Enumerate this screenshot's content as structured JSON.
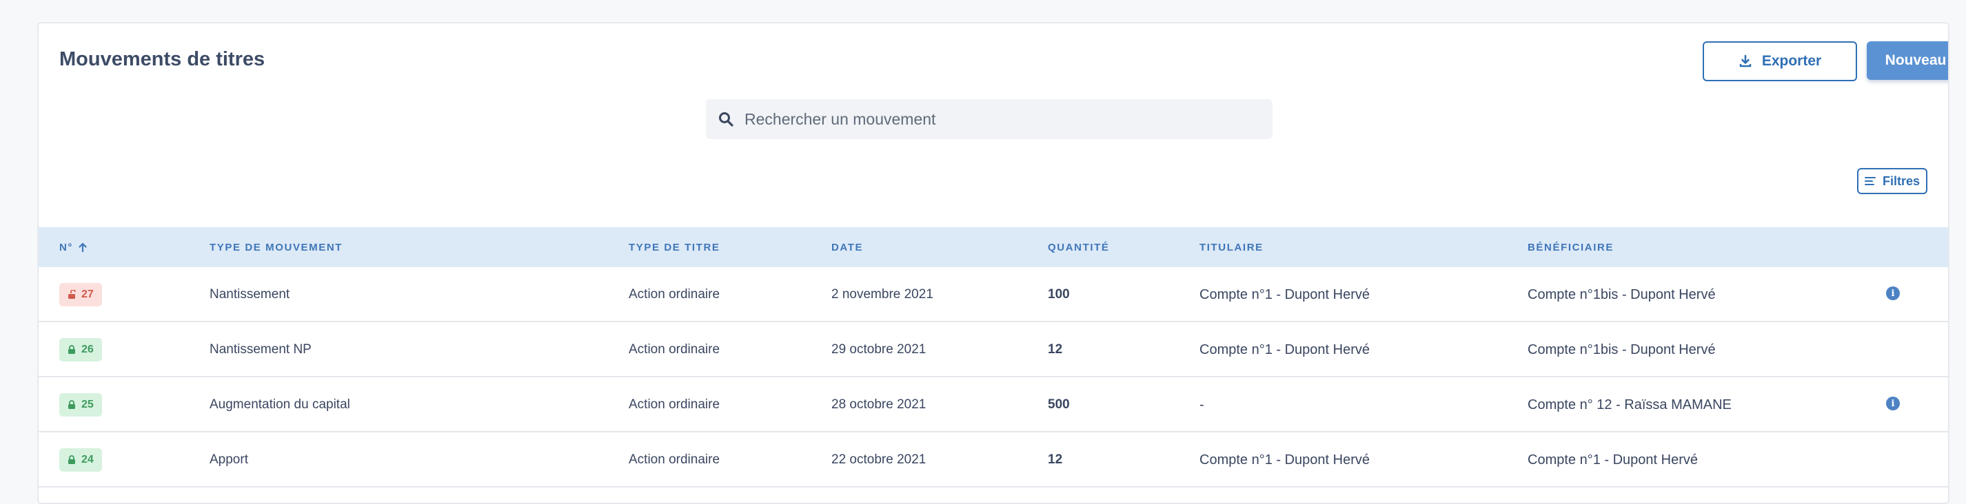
{
  "header": {
    "title": "Mouvements de titres",
    "export_label": "Exporter",
    "new_label": "Nouveau"
  },
  "search": {
    "placeholder": "Rechercher un mouvement"
  },
  "filters": {
    "label": "Filtres"
  },
  "colors": {
    "accent": "#2f6fb5",
    "primary_button": "#5b92d3",
    "header_row": "#dce9f7",
    "badge_red_bg": "#fbe0dd",
    "badge_green_bg": "#d7f2df"
  },
  "table": {
    "columns": {
      "num": "N°",
      "type_mouvement": "TYPE DE MOUVEMENT",
      "type_titre": "TYPE DE TITRE",
      "date": "DATE",
      "quantite": "QUANTITÉ",
      "titulaire": "TITULAIRE",
      "beneficiaire": "BÉNÉFICIAIRE"
    },
    "sort_icon": "arrow-up-icon",
    "rows": [
      {
        "num": "27",
        "badge": "red",
        "icon": "unlock-icon",
        "type_mouvement": "Nantissement",
        "type_titre": "Action ordinaire",
        "date": "2 novembre 2021",
        "quantite": "100",
        "titulaire": "Compte n°1 - Dupont Hervé",
        "beneficiaire": "Compte n°1bis - Dupont Hervé",
        "info": true
      },
      {
        "num": "26",
        "badge": "green",
        "icon": "lock-icon",
        "type_mouvement": "Nantissement NP",
        "type_titre": "Action ordinaire",
        "date": "29 octobre 2021",
        "quantite": "12",
        "titulaire": "Compte n°1 - Dupont Hervé",
        "beneficiaire": "Compte n°1bis - Dupont Hervé",
        "info": false
      },
      {
        "num": "25",
        "badge": "green",
        "icon": "lock-icon",
        "type_mouvement": "Augmentation du capital",
        "type_titre": "Action ordinaire",
        "date": "28 octobre 2021",
        "quantite": "500",
        "titulaire": "-",
        "beneficiaire": "Compte n° 12 - Raïssa MAMANE",
        "info": true
      },
      {
        "num": "24",
        "badge": "green",
        "icon": "lock-icon",
        "type_mouvement": "Apport",
        "type_titre": "Action ordinaire",
        "date": "22 octobre 2021",
        "quantite": "12",
        "titulaire": "Compte n°1 - Dupont Hervé",
        "beneficiaire": "Compte n°1 - Dupont Hervé",
        "info": false
      }
    ]
  }
}
